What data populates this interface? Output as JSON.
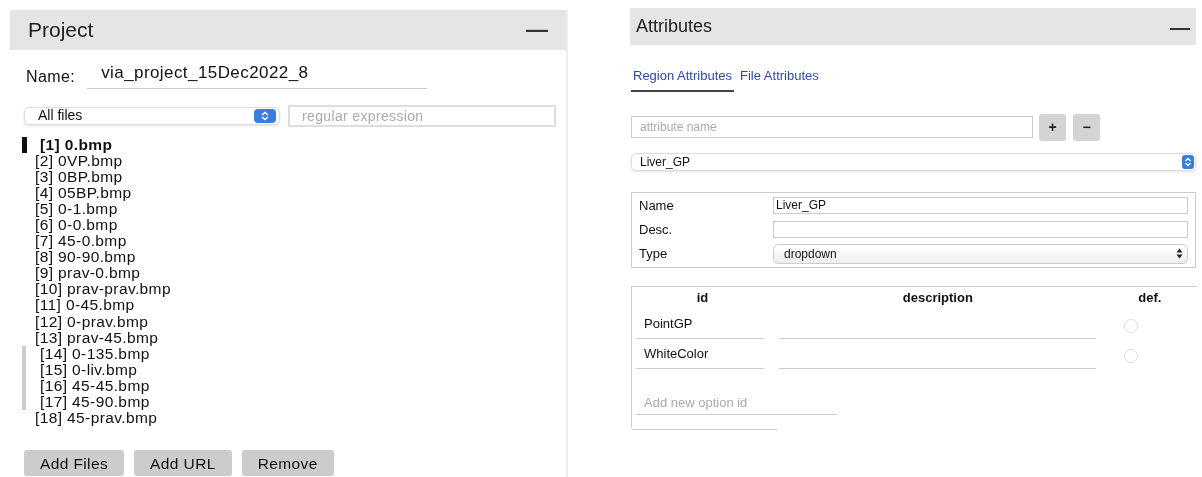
{
  "project": {
    "title": "Project",
    "collapse_icon": "—",
    "name_label": "Name:",
    "name_value": "via_project_15Dec2022_8",
    "filter": {
      "value": "All files"
    },
    "search": {
      "placeholder": "regular expression"
    },
    "files": [
      {
        "label": "[1] 0.bmp",
        "selected": true,
        "marked": false
      },
      {
        "label": "[2] 0VP.bmp",
        "selected": false,
        "marked": false
      },
      {
        "label": "[3] 0BP.bmp",
        "selected": false,
        "marked": false
      },
      {
        "label": "[4] 05BP.bmp",
        "selected": false,
        "marked": false
      },
      {
        "label": "[5] 0-1.bmp",
        "selected": false,
        "marked": false
      },
      {
        "label": "[6] 0-0.bmp",
        "selected": false,
        "marked": false
      },
      {
        "label": "[7] 45-0.bmp",
        "selected": false,
        "marked": false
      },
      {
        "label": "[8] 90-90.bmp",
        "selected": false,
        "marked": false
      },
      {
        "label": "[9] prav-0.bmp",
        "selected": false,
        "marked": false
      },
      {
        "label": "[10] prav-prav.bmp",
        "selected": false,
        "marked": false
      },
      {
        "label": "[11] 0-45.bmp",
        "selected": false,
        "marked": false
      },
      {
        "label": "[12] 0-prav.bmp",
        "selected": false,
        "marked": false
      },
      {
        "label": "[13] prav-45.bmp",
        "selected": false,
        "marked": false
      },
      {
        "label": "[14] 0-135.bmp",
        "selected": false,
        "marked": true
      },
      {
        "label": "[15] 0-liv.bmp",
        "selected": false,
        "marked": true
      },
      {
        "label": "[16] 45-45.bmp",
        "selected": false,
        "marked": true
      },
      {
        "label": "[17] 45-90.bmp",
        "selected": false,
        "marked": true
      },
      {
        "label": "[18] 45-prav.bmp",
        "selected": false,
        "marked": false
      }
    ],
    "buttons": [
      "Add Files",
      "Add URL",
      "Remove"
    ]
  },
  "attributes": {
    "title": "Attributes",
    "collapse_icon": "—",
    "tabs": [
      {
        "label": "Region Attributes",
        "selected": true
      },
      {
        "label": "File Attributes",
        "selected": false
      }
    ],
    "attribute_name": {
      "placeholder": "attribute name"
    },
    "add_button": "+",
    "remove_button": "−",
    "attribute_select": {
      "value": "Liver_GP"
    },
    "properties": [
      {
        "label": "Name",
        "kind": "text",
        "value": "Liver_GP"
      },
      {
        "label": "Desc.",
        "kind": "text"
      },
      {
        "label": "Type",
        "kind": "select",
        "value": "dropdown"
      }
    ],
    "options": {
      "columns": [
        "id",
        "description",
        "def."
      ],
      "rows": [
        {
          "id": "PointGP",
          "default": false
        },
        {
          "id": "WhiteColor",
          "default": false
        }
      ],
      "new_option": {
        "placeholder": "Add new option id"
      }
    }
  }
}
